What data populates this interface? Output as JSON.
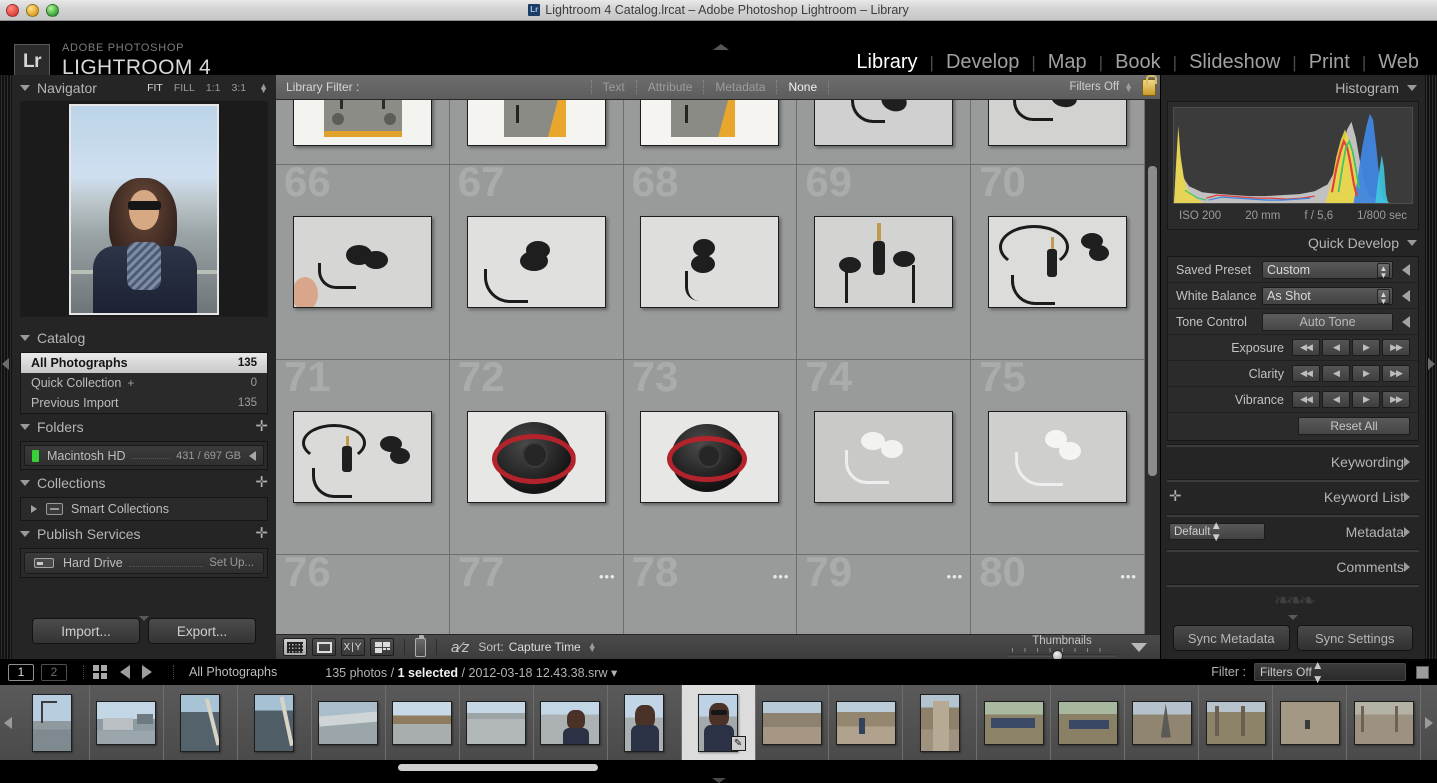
{
  "os_titlebar": {
    "title": "Lightroom 4 Catalog.lrcat – Adobe Photoshop Lightroom – Library",
    "app_badge": "Lr"
  },
  "header": {
    "logo": "Lr",
    "brand_line1": "ADOBE PHOTOSHOP",
    "brand_line2": "LIGHTROOM 4",
    "modules": [
      {
        "label": "Library",
        "active": true
      },
      {
        "label": "Develop",
        "active": false
      },
      {
        "label": "Map",
        "active": false
      },
      {
        "label": "Book",
        "active": false
      },
      {
        "label": "Slideshow",
        "active": false
      },
      {
        "label": "Print",
        "active": false
      },
      {
        "label": "Web",
        "active": false
      }
    ]
  },
  "left_panel": {
    "navigator": {
      "title": "Navigator",
      "zoom_levels": [
        "FIT",
        "FILL",
        "1:1",
        "3:1"
      ],
      "selected_zoom": "FIT"
    },
    "catalog": {
      "title": "Catalog",
      "items": [
        {
          "label": "All Photographs",
          "count": "135",
          "selected": true
        },
        {
          "label": "Quick Collection",
          "count": "0",
          "plus": "+",
          "selected": false
        },
        {
          "label": "Previous Import",
          "count": "135",
          "selected": false
        }
      ]
    },
    "folders": {
      "title": "Folders",
      "items": [
        {
          "label": "Macintosh HD",
          "detail": "431 / 697 GB"
        }
      ]
    },
    "collections": {
      "title": "Collections",
      "items": [
        {
          "label": "Smart Collections"
        }
      ]
    },
    "publish_services": {
      "title": "Publish Services",
      "items": [
        {
          "label": "Hard Drive",
          "action": "Set Up..."
        }
      ]
    },
    "buttons": {
      "import": "Import...",
      "export": "Export..."
    }
  },
  "library_filter": {
    "label": "Library Filter :",
    "tabs": [
      {
        "label": "Text",
        "active": false
      },
      {
        "label": "Attribute",
        "active": false
      },
      {
        "label": "Metadata",
        "active": false
      },
      {
        "label": "None",
        "active": true
      }
    ],
    "filters_state": "Filters Off"
  },
  "grid": {
    "rows": [
      {
        "cells": [
          {
            "number": "",
            "orientation": "wide",
            "kind": "box-top"
          },
          {
            "number": "",
            "orientation": "wide",
            "kind": "box-side"
          },
          {
            "number": "",
            "orientation": "wide",
            "kind": "box-side2"
          },
          {
            "number": "",
            "orientation": "wide",
            "kind": "buds-a"
          },
          {
            "number": "",
            "orientation": "wide",
            "kind": "buds-b"
          }
        ]
      },
      {
        "cells": [
          {
            "number": "66",
            "orientation": "wide",
            "kind": "buds-hand"
          },
          {
            "number": "67",
            "orientation": "wide",
            "kind": "buds-c"
          },
          {
            "number": "68",
            "orientation": "wide",
            "kind": "buds-d"
          },
          {
            "number": "69",
            "orientation": "wide",
            "kind": "buds-jack"
          },
          {
            "number": "70",
            "orientation": "wide",
            "kind": "buds-cord"
          }
        ]
      },
      {
        "cells": [
          {
            "number": "71",
            "orientation": "wide",
            "kind": "buds-cord2"
          },
          {
            "number": "72",
            "orientation": "wide",
            "kind": "case-red"
          },
          {
            "number": "73",
            "orientation": "wide",
            "kind": "case-red2"
          },
          {
            "number": "74",
            "orientation": "wide",
            "kind": "buds-white"
          },
          {
            "number": "75",
            "orientation": "wide",
            "kind": "buds-white2"
          }
        ]
      },
      {
        "cells": [
          {
            "number": "76",
            "orientation": "wide",
            "kind": "empty",
            "dots": ""
          },
          {
            "number": "77",
            "orientation": "wide",
            "kind": "empty",
            "dots": "•••"
          },
          {
            "number": "78",
            "orientation": "wide",
            "kind": "empty",
            "dots": "•••"
          },
          {
            "number": "79",
            "orientation": "wide",
            "kind": "empty",
            "dots": "•••"
          },
          {
            "number": "80",
            "orientation": "wide",
            "kind": "empty",
            "dots": "•••"
          }
        ]
      }
    ]
  },
  "toolbar": {
    "view_modes": [
      "grid-view",
      "loupe-view",
      "compare-view",
      "survey-view"
    ],
    "painter": "spray-can",
    "sort_label": "Sort:",
    "sort_value": "Capture Time",
    "thumbnails_label": "Thumbnails"
  },
  "right_panel": {
    "histogram": {
      "title": "Histogram",
      "iso": "ISO 200",
      "focal": "20 mm",
      "aperture": "f / 5,6",
      "shutter": "1/800 sec"
    },
    "quick_develop": {
      "title": "Quick Develop",
      "saved_preset_label": "Saved Preset",
      "saved_preset_value": "Custom",
      "white_balance_label": "White Balance",
      "white_balance_value": "As Shot",
      "tone_control_label": "Tone Control",
      "auto_tone": "Auto Tone",
      "exposure_label": "Exposure",
      "clarity_label": "Clarity",
      "vibrance_label": "Vibrance",
      "reset_all": "Reset All"
    },
    "sections": [
      {
        "label": "Keywording"
      },
      {
        "label": "Keyword List"
      },
      {
        "label": "Metadata",
        "preset": "Default"
      },
      {
        "label": "Comments"
      }
    ],
    "buttons": {
      "sync_metadata": "Sync Metadata",
      "sync_settings": "Sync Settings"
    }
  },
  "status_bar": {
    "page1": "1",
    "page2": "2",
    "source": "All Photographs",
    "photos_count": "135 photos",
    "selected": "1 selected",
    "filename": "2012-03-18 12.43.38.srw",
    "separator1": "/",
    "separator2": "/",
    "filter_label": "Filter :",
    "filter_value": "Filters Off"
  },
  "filmstrip": {
    "items": [
      {
        "kind": "crane",
        "orientation": "tall",
        "selected": false
      },
      {
        "kind": "boat",
        "orientation": "wide",
        "selected": false
      },
      {
        "kind": "rope",
        "orientation": "tall",
        "selected": false
      },
      {
        "kind": "rope2",
        "orientation": "tall",
        "selected": false
      },
      {
        "kind": "rail",
        "orientation": "wide",
        "selected": false
      },
      {
        "kind": "shore",
        "orientation": "wide",
        "selected": false
      },
      {
        "kind": "river",
        "orientation": "wide",
        "selected": false
      },
      {
        "kind": "portrait1",
        "orientation": "wide",
        "selected": false
      },
      {
        "kind": "portrait2",
        "orientation": "tall",
        "selected": false
      },
      {
        "kind": "portrait3",
        "orientation": "tall",
        "selected": true,
        "badge": "✎"
      },
      {
        "kind": "path1",
        "orientation": "wide",
        "selected": false
      },
      {
        "kind": "path2",
        "orientation": "wide",
        "selected": false
      },
      {
        "kind": "pillar",
        "orientation": "tall",
        "selected": false
      },
      {
        "kind": "bikes",
        "orientation": "wide",
        "selected": false
      },
      {
        "kind": "bikes2",
        "orientation": "wide",
        "selected": false
      },
      {
        "kind": "church",
        "orientation": "wide",
        "selected": false
      },
      {
        "kind": "trees",
        "orientation": "wide",
        "selected": false
      },
      {
        "kind": "alley",
        "orientation": "wide",
        "selected": false
      },
      {
        "kind": "alley2",
        "orientation": "wide",
        "selected": false
      }
    ]
  }
}
